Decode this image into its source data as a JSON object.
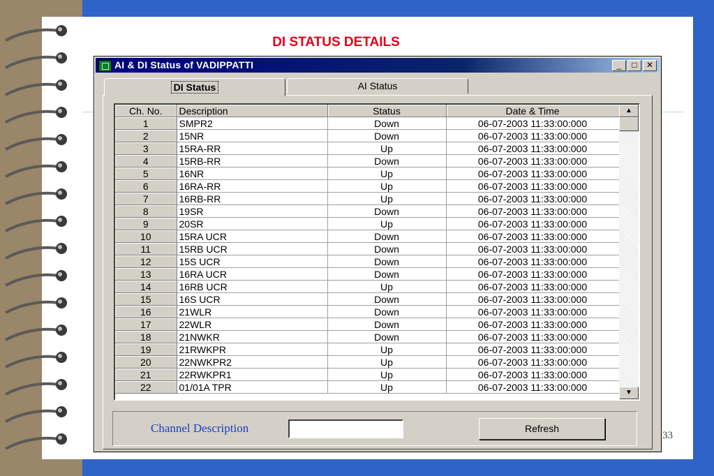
{
  "slide": {
    "title": "DI STATUS DETAILS",
    "page_number": "33"
  },
  "window": {
    "title": "AI & DI Status of VADIPPATTI",
    "minimize": "_",
    "maximize": "□",
    "close": "✕"
  },
  "tabs": [
    {
      "label": "DI Status",
      "active": true
    },
    {
      "label": "AI Status",
      "active": false
    }
  ],
  "table": {
    "columns": [
      "Ch. No.",
      "Description",
      "Status",
      "Date & Time"
    ],
    "rows": [
      {
        "ch": "1",
        "desc": "SMPR2",
        "status": "Down",
        "datetime": "06-07-2003 11:33:00:000"
      },
      {
        "ch": "2",
        "desc": "15NR",
        "status": "Down",
        "datetime": "06-07-2003 11:33:00:000"
      },
      {
        "ch": "3",
        "desc": "15RA-RR",
        "status": "Up",
        "datetime": "06-07-2003 11:33:00:000"
      },
      {
        "ch": "4",
        "desc": "15RB-RR",
        "status": "Down",
        "datetime": "06-07-2003 11:33:00:000"
      },
      {
        "ch": "5",
        "desc": "16NR",
        "status": "Up",
        "datetime": "06-07-2003 11:33:00:000"
      },
      {
        "ch": "6",
        "desc": "16RA-RR",
        "status": "Up",
        "datetime": "06-07-2003 11:33:00:000"
      },
      {
        "ch": "7",
        "desc": "16RB-RR",
        "status": "Up",
        "datetime": "06-07-2003 11:33:00:000"
      },
      {
        "ch": "8",
        "desc": "19SR",
        "status": "Down",
        "datetime": "06-07-2003 11:33:00:000"
      },
      {
        "ch": "9",
        "desc": "20SR",
        "status": "Up",
        "datetime": "06-07-2003 11:33:00:000"
      },
      {
        "ch": "10",
        "desc": "15RA UCR",
        "status": "Down",
        "datetime": "06-07-2003 11:33:00:000"
      },
      {
        "ch": "11",
        "desc": "15RB UCR",
        "status": "Down",
        "datetime": "06-07-2003 11:33:00:000"
      },
      {
        "ch": "12",
        "desc": "15S UCR",
        "status": "Down",
        "datetime": "06-07-2003 11:33:00:000"
      },
      {
        "ch": "13",
        "desc": "16RA UCR",
        "status": "Down",
        "datetime": "06-07-2003 11:33:00:000"
      },
      {
        "ch": "14",
        "desc": "16RB UCR",
        "status": "Up",
        "datetime": "06-07-2003 11:33:00:000"
      },
      {
        "ch": "15",
        "desc": "16S UCR",
        "status": "Down",
        "datetime": "06-07-2003 11:33:00:000"
      },
      {
        "ch": "16",
        "desc": "21WLR",
        "status": "Down",
        "datetime": "06-07-2003 11:33:00:000"
      },
      {
        "ch": "17",
        "desc": "22WLR",
        "status": "Down",
        "datetime": "06-07-2003 11:33:00:000"
      },
      {
        "ch": "18",
        "desc": "21NWKR",
        "status": "Down",
        "datetime": "06-07-2003 11:33:00:000"
      },
      {
        "ch": "19",
        "desc": "21RWKPR",
        "status": "Up",
        "datetime": "06-07-2003 11:33:00:000"
      },
      {
        "ch": "20",
        "desc": "22NWKPR2",
        "status": "Up",
        "datetime": "06-07-2003 11:33:00:000"
      },
      {
        "ch": "21",
        "desc": "22RWKPR1",
        "status": "Up",
        "datetime": "06-07-2003 11:33:00:000"
      },
      {
        "ch": "22",
        "desc": "01/01A TPR",
        "status": "Up",
        "datetime": "06-07-2003 11:33:00:000"
      }
    ]
  },
  "scrollbar": {
    "up": "▲",
    "down": "▼"
  },
  "bottom": {
    "channel_label": "Channel Description",
    "channel_value": "",
    "refresh_label": "Refresh"
  },
  "colors": {
    "frame_blue": "#2f63c8",
    "title_red": "#e3001b",
    "label_blue": "#1d3fbf",
    "window_gray": "#d4d0c8"
  }
}
